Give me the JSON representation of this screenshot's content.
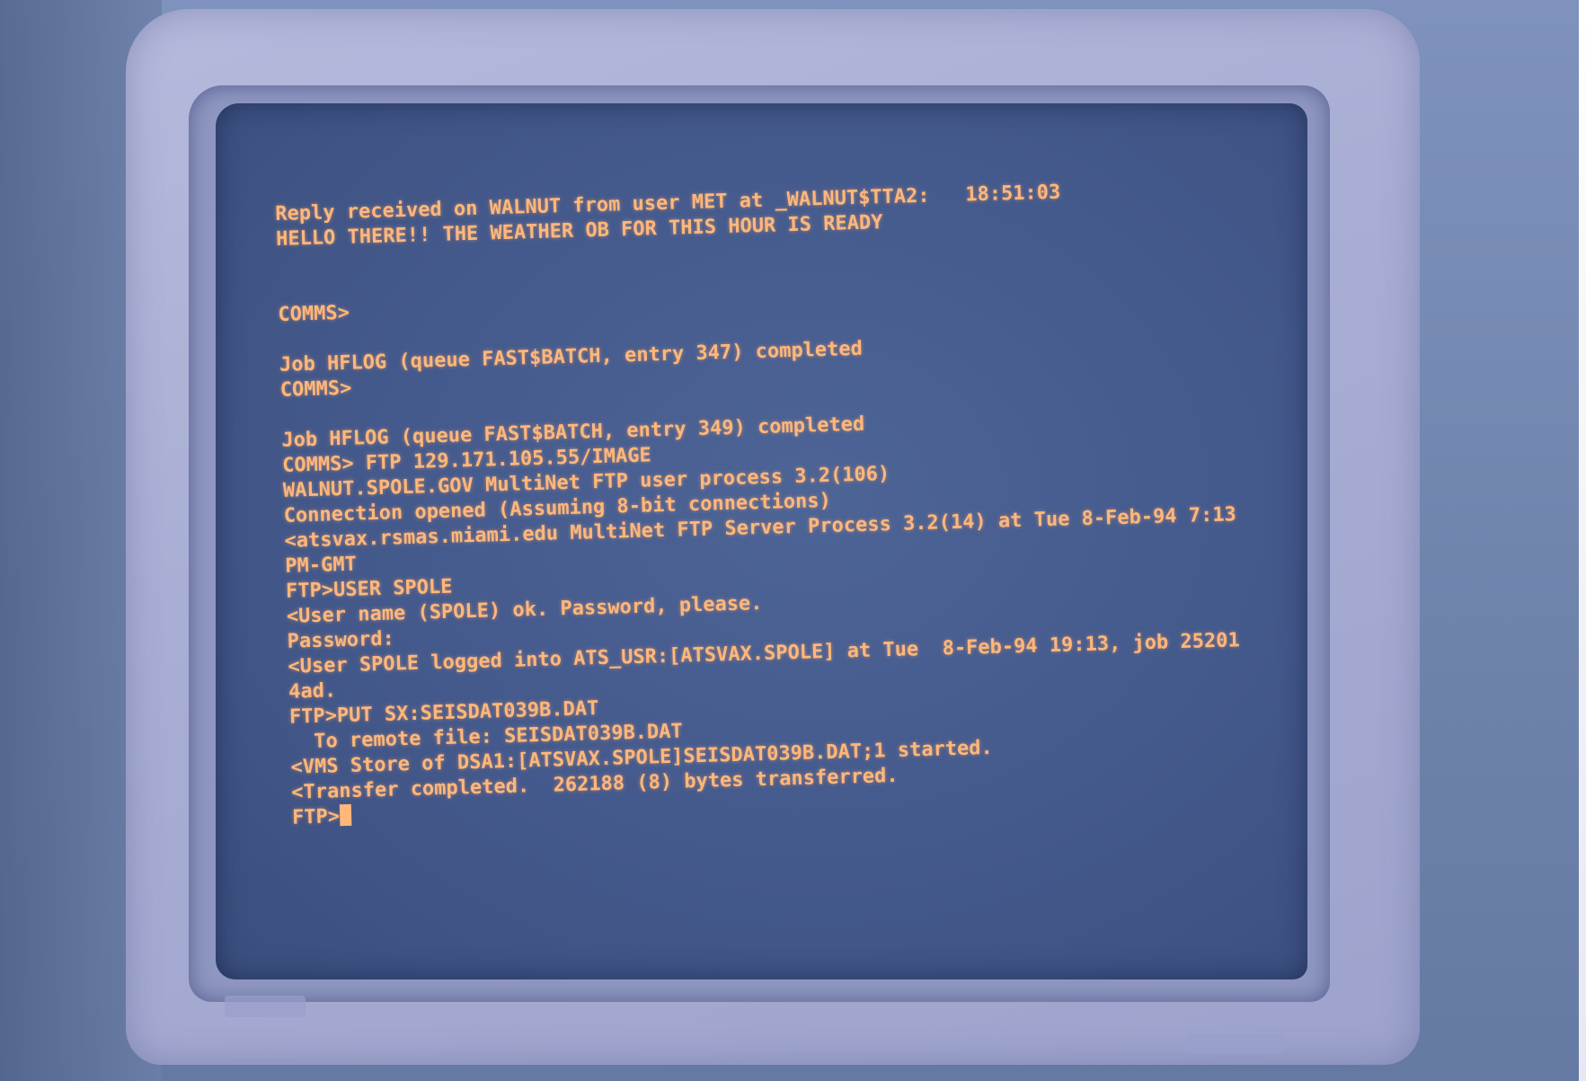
{
  "terminal": {
    "lines": [
      "Reply received on WALNUT from user MET at _WALNUT$TTA2:   18:51:03",
      "HELLO THERE!! THE WEATHER OB FOR THIS HOUR IS READY",
      "",
      "",
      "COMMS>",
      "",
      "Job HFLOG (queue FAST$BATCH, entry 347) completed",
      "COMMS>",
      "",
      "Job HFLOG (queue FAST$BATCH, entry 349) completed",
      "COMMS> FTP 129.171.105.55/IMAGE",
      "WALNUT.SPOLE.GOV MultiNet FTP user process 3.2(106)",
      "Connection opened (Assuming 8-bit connections)",
      "<atsvax.rsmas.miami.edu MultiNet FTP Server Process 3.2(14) at Tue 8-Feb-94 7:13",
      "PM-GMT",
      "FTP>USER SPOLE",
      "<User name (SPOLE) ok. Password, please.",
      "Password:",
      "<User SPOLE logged into ATS_USR:[ATSVAX.SPOLE] at Tue  8-Feb-94 19:13, job 25201",
      "4ad.",
      "FTP>PUT SX:SEISDAT039B.DAT",
      "  To remote file: SEISDAT039B.DAT",
      "<VMS Store of DSA1:[ATSVAX.SPOLE]SEISDAT039B.DAT;1 started.",
      "<Transfer completed.  262188 (8) bytes transferred."
    ],
    "prompt": "FTP>"
  },
  "colors": {
    "phosphor_text": "#ffb77a",
    "screen_background": "#44598b",
    "bezel": "#a9aed4"
  }
}
